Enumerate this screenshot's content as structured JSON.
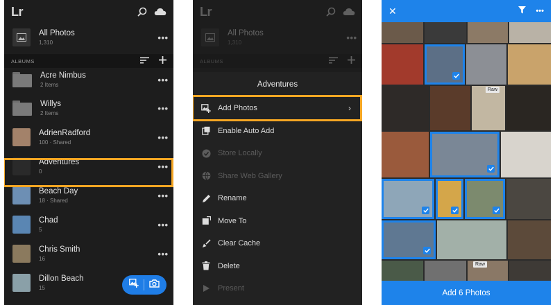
{
  "panel1": {
    "logo": "Lr",
    "all_photos": {
      "title": "All Photos",
      "count": "1,310"
    },
    "albums_header": "ALBUMS",
    "albums": [
      {
        "title": "Acre Nimbus",
        "sub": "2 Items",
        "thumb": "folder"
      },
      {
        "title": "Willys",
        "sub": "2 Items",
        "thumb": "folder"
      },
      {
        "title": "AdrienRadford",
        "sub": "100 · Shared",
        "thumb": "#a3826a"
      },
      {
        "title": "Adventures",
        "sub": "0",
        "thumb": "#2a2a2a"
      },
      {
        "title": "Beach Day",
        "sub": "18 · Shared",
        "thumb": "#6d8fb4"
      },
      {
        "title": "Chad",
        "sub": "5",
        "thumb": "#5a86b3"
      },
      {
        "title": "Chris Smith",
        "sub": "16",
        "thumb": "#8b7a5e"
      },
      {
        "title": "Dillon Beach",
        "sub": "15",
        "thumb": "#8aa0a8"
      }
    ],
    "more_label": "•••"
  },
  "panel2": {
    "logo": "Lr",
    "all_photos": {
      "title": "All Photos",
      "count": "1,310"
    },
    "albums_header": "ALBUMS",
    "sheet_title": "Adventures",
    "menu": [
      {
        "label": "Add Photos",
        "icon": "add-photos-icon",
        "enabled": true,
        "chevron": "›"
      },
      {
        "label": "Enable Auto Add",
        "icon": "auto-add-icon",
        "enabled": true
      },
      {
        "label": "Store Locally",
        "icon": "store-locally-icon",
        "enabled": false
      },
      {
        "label": "Share Web Gallery",
        "icon": "globe-icon",
        "enabled": false
      },
      {
        "label": "Rename",
        "icon": "pencil-icon",
        "enabled": true
      },
      {
        "label": "Move To",
        "icon": "move-to-icon",
        "enabled": true
      },
      {
        "label": "Clear Cache",
        "icon": "broom-icon",
        "enabled": true
      },
      {
        "label": "Delete",
        "icon": "trash-icon",
        "enabled": true
      },
      {
        "label": "Present",
        "icon": "play-icon",
        "enabled": false
      }
    ]
  },
  "panel3": {
    "close_label": "✕",
    "raw_label": "Raw",
    "add_button": "Add 6 Photos"
  },
  "colors": {
    "accent": "#1e83ea",
    "highlight": "#f5a623",
    "dark_bg": "#1d1d1d"
  }
}
